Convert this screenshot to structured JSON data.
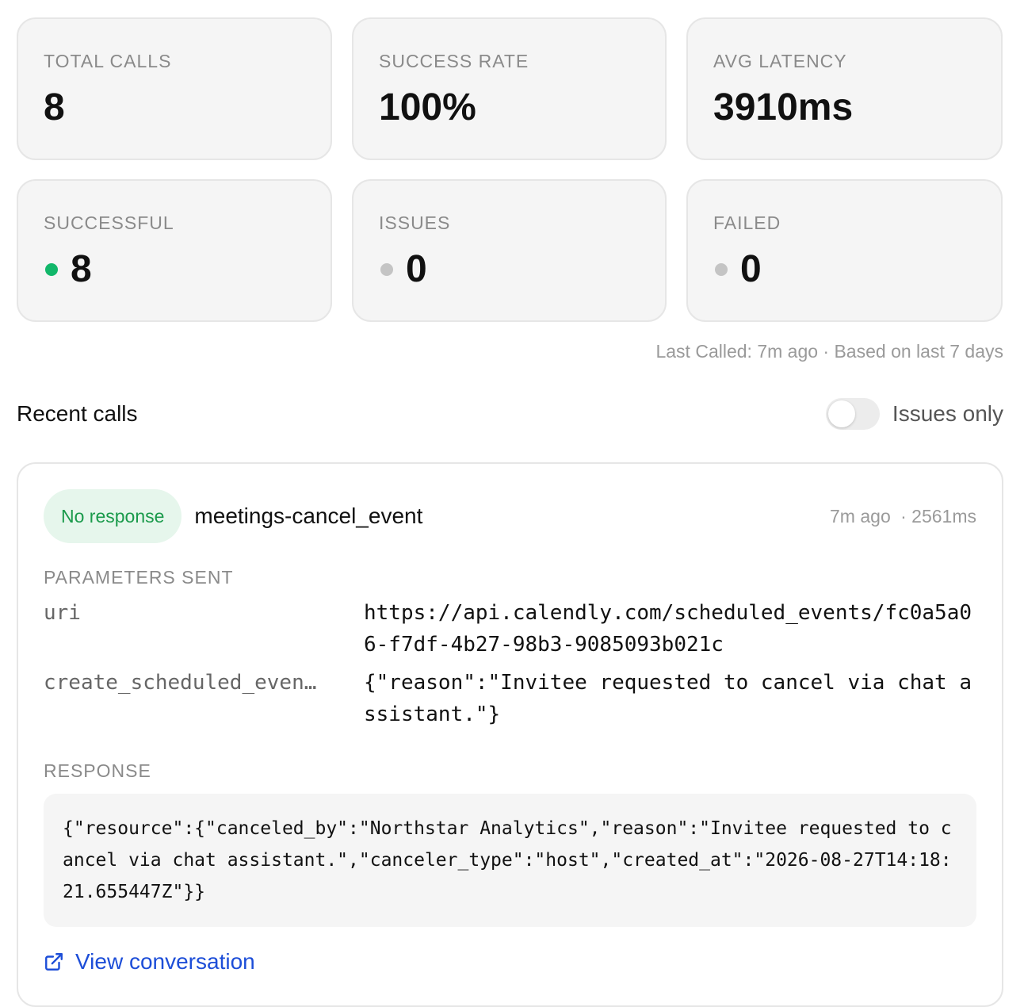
{
  "stats": {
    "total_calls": {
      "label": "TOTAL CALLS",
      "value": "8"
    },
    "success_rate": {
      "label": "SUCCESS RATE",
      "value": "100%"
    },
    "avg_latency": {
      "label": "AVG LATENCY",
      "value": "3910ms"
    },
    "successful": {
      "label": "SUCCESSFUL",
      "value": "8",
      "dot_color": "#12b76a"
    },
    "issues": {
      "label": "ISSUES",
      "value": "0",
      "dot_color": "#c4c4c4"
    },
    "failed": {
      "label": "FAILED",
      "value": "0",
      "dot_color": "#c4c4c4"
    }
  },
  "meta_line": "Last Called: 7m ago · Based on last 7 days",
  "recent_calls": {
    "title": "Recent calls",
    "toggle_label": "Issues only",
    "toggle_on": false
  },
  "call": {
    "status_badge": "No response",
    "tool_name": "meetings-cancel_event",
    "time_ago": "7m ago",
    "duration": "· 2561ms",
    "params_label": "PARAMETERS SENT",
    "params": [
      {
        "key": "uri",
        "value": "https://api.calendly.com/scheduled_events/fc0a5a06-f7df-4b27-98b3-9085093b021c"
      },
      {
        "key": "create_scheduled_even…",
        "value": "{\"reason\":\"Invitee requested to cancel via chat assistant.\"}"
      }
    ],
    "response_label": "RESPONSE",
    "response_body": "{\"resource\":{\"canceled_by\":\"Northstar Analytics\",\"reason\":\"Invitee requested to cancel via chat assistant.\",\"canceler_type\":\"host\",\"created_at\":\"2026-08-27T14:18:21.655447Z\"}}",
    "view_link": "View conversation"
  },
  "colors": {
    "accent_link": "#1d4ed8",
    "badge_bg": "#e6f6ec",
    "badge_text": "#1a9a4b"
  },
  "icons": {
    "external_link": "external-link-icon"
  }
}
